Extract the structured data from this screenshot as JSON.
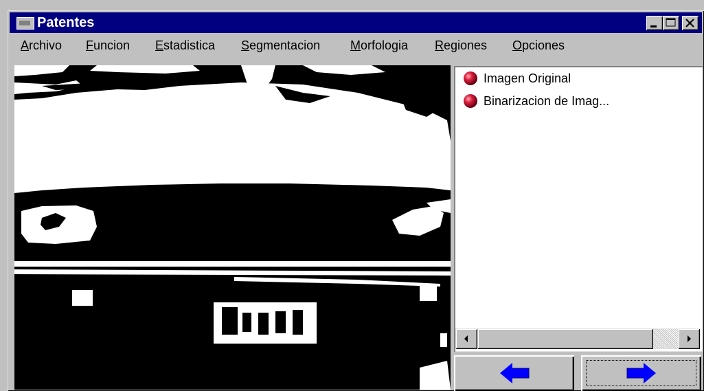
{
  "window": {
    "title": "Patentes"
  },
  "titlebar_buttons": [
    "minimize-icon",
    "maximize-icon",
    "close-icon"
  ],
  "menu": [
    {
      "first": "A",
      "rest": "rchivo"
    },
    {
      "first": "F",
      "rest": "uncion"
    },
    {
      "first": "E",
      "rest": "stadistica"
    },
    {
      "first": "S",
      "rest": "egmentacion"
    },
    {
      "first": "M",
      "rest": "orfologia"
    },
    {
      "first": "R",
      "rest": "egiones"
    },
    {
      "first": "O",
      "rest": "pciones"
    }
  ],
  "list": {
    "items": [
      {
        "label": "Imagen Original",
        "icon": "red-ball-icon"
      },
      {
        "label": "Binarizacion de Imag...",
        "icon": "red-ball-icon"
      }
    ]
  },
  "image": {
    "plate_text": "AS·VLJ"
  },
  "nav": {
    "back_icon": "left-arrow-icon",
    "forward_icon": "right-arrow-icon"
  },
  "colors": {
    "title_bg": "#000080",
    "arrow_blue": "#0000ff",
    "ball_red": "#c00020"
  }
}
